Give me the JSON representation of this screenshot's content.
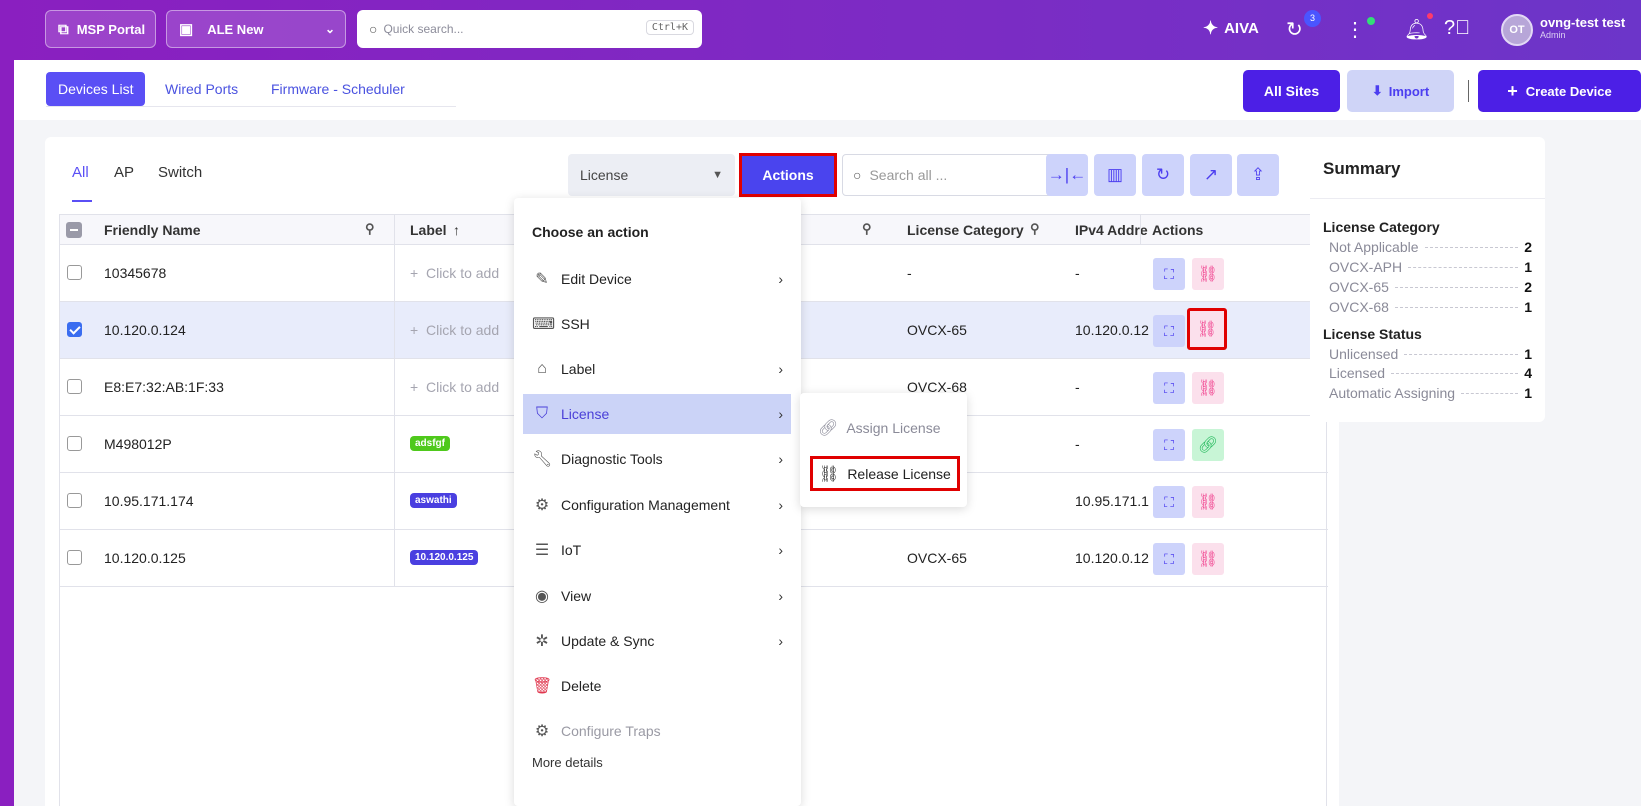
{
  "topbar": {
    "msp_portal": "MSP Portal",
    "org_select": "ALE New",
    "quick_search_placeholder": "Quick search...",
    "quick_search_shortcut": "Ctrl+K",
    "aiva": "AIVA",
    "notifications_count": "3",
    "user_initials": "OT",
    "user_name": "ovng-test test",
    "user_role": "Admin"
  },
  "subnav": {
    "tabs": [
      {
        "label": "Devices List"
      },
      {
        "label": "Wired Ports"
      },
      {
        "label": "Firmware - Scheduler"
      }
    ],
    "all_sites": "All Sites",
    "import": "Import",
    "create_device": "Create Device"
  },
  "filters": {
    "tabs": [
      {
        "label": "All"
      },
      {
        "label": "AP"
      },
      {
        "label": "Switch"
      }
    ],
    "column_select": "License",
    "actions": "Actions",
    "search_placeholder": "Search all ..."
  },
  "table": {
    "headers": {
      "friendly_name": "Friendly Name",
      "label": "Label",
      "license_category": "License Category",
      "ipv4": "IPv4 Addre",
      "actions": "Actions"
    },
    "click_to_add": "Click to add",
    "rows": [
      {
        "name": "10345678",
        "label": "",
        "license_category": "-",
        "ipv4": "-"
      },
      {
        "name": "10.120.0.124",
        "label": "",
        "license_category": "OVCX-65",
        "ipv4": "10.120.0.12"
      },
      {
        "name": "E8:E7:32:AB:1F:33",
        "label": "",
        "license_category": "OVCX-68",
        "ipv4": "-"
      },
      {
        "name": "M498012P",
        "label": "adsfgf",
        "license_category": "",
        "ipv4": "-"
      },
      {
        "name": "10.95.171.174",
        "label": "aswathi",
        "license_category": "",
        "ipv4": "10.95.171.1"
      },
      {
        "name": "10.120.0.125",
        "label": "10.120.0.125",
        "license_category": "OVCX-65",
        "ipv4": "10.120.0.12"
      }
    ]
  },
  "summary": {
    "title": "Summary",
    "license_category_title": "License Category",
    "license_category": [
      {
        "label": "Not Applicable",
        "value": "2"
      },
      {
        "label": "OVCX-APH",
        "value": "1"
      },
      {
        "label": "OVCX-65",
        "value": "2"
      },
      {
        "label": "OVCX-68",
        "value": "1"
      }
    ],
    "license_status_title": "License Status",
    "license_status": [
      {
        "label": "Unlicensed",
        "value": "1"
      },
      {
        "label": "Licensed",
        "value": "4"
      },
      {
        "label": "Automatic Assigning",
        "value": "1"
      }
    ]
  },
  "action_menu": {
    "title": "Choose an action",
    "items": [
      {
        "label": "Edit Device"
      },
      {
        "label": "SSH"
      },
      {
        "label": "Label"
      },
      {
        "label": "License"
      },
      {
        "label": "Diagnostic Tools"
      },
      {
        "label": "Configuration Management"
      },
      {
        "label": "IoT"
      },
      {
        "label": "View"
      },
      {
        "label": "Update & Sync"
      },
      {
        "label": "Delete"
      },
      {
        "label": "Configure Traps"
      }
    ],
    "more": "More details"
  },
  "license_submenu": {
    "assign": "Assign License",
    "release": "Release License"
  },
  "colors": {
    "brand_purple": "#7b2cc4",
    "primary": "#4c1fe6",
    "highlight_red": "#e00000"
  }
}
